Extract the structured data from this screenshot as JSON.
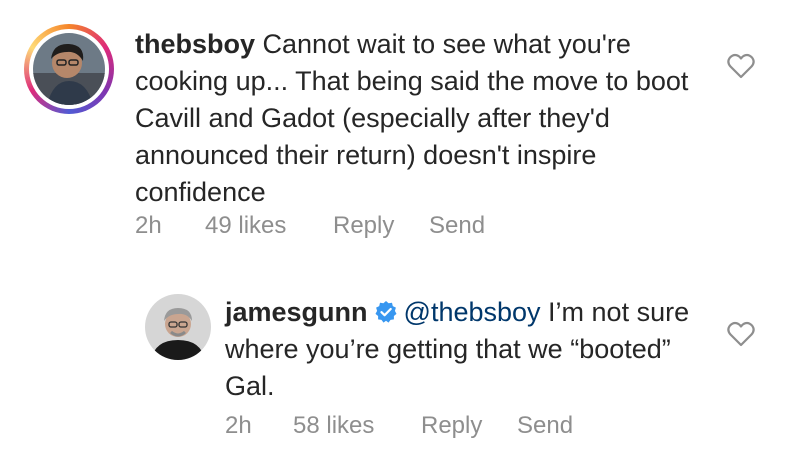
{
  "comments": [
    {
      "username": "thebsboy",
      "text": "Cannot wait to see what you're cooking up... That being said the move to boot Cavill and Gadot (especially after they'd announced their return) doesn't inspire confidence",
      "time": "2h",
      "likes": "49 likes",
      "reply_label": "Reply",
      "send_label": "Send",
      "avatar": "user-photo-avatar",
      "story_ring": true,
      "like_icon": "heart-outline-icon"
    },
    {
      "username": "jamesgunn",
      "verified": true,
      "verified_icon": "verified-badge-icon",
      "mention": "@thebsboy",
      "text": "I’m not sure where you’re getting that we “booted” Gal.",
      "time": "2h",
      "likes": "58 likes",
      "reply_label": "Reply",
      "send_label": "Send",
      "avatar": "user-photo-avatar",
      "like_icon": "heart-outline-icon"
    }
  ],
  "colors": {
    "text": "#262626",
    "meta": "#8e8e8e",
    "mention": "#00376b",
    "verified": "#3897f0",
    "background": "#ffffff"
  }
}
